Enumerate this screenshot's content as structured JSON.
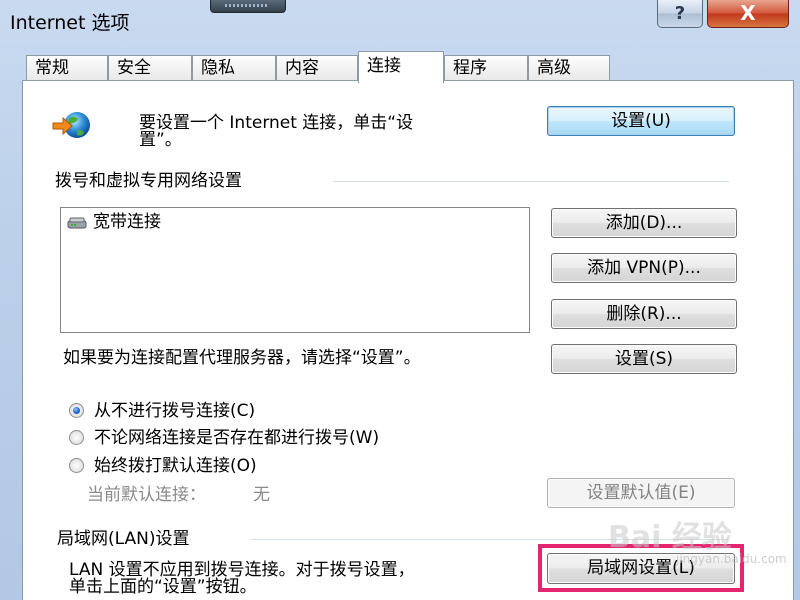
{
  "window": {
    "title": "Internet 选项",
    "help_label": "?",
    "close_label": "X"
  },
  "tabs": [
    {
      "label": "常规"
    },
    {
      "label": "安全"
    },
    {
      "label": "隐私"
    },
    {
      "label": "内容"
    },
    {
      "label": "连接",
      "active": true
    },
    {
      "label": "程序"
    },
    {
      "label": "高级"
    }
  ],
  "internet_setup": {
    "icon": "globe-arrow-icon",
    "text_line1": "要设置一个 Internet 连接，单击“设",
    "text_line2": "置”。",
    "button": "设置(U)"
  },
  "dialup": {
    "section_title": "拨号和虚拟专用网络设置",
    "connections": [
      {
        "icon": "modem-icon",
        "name": "宽带连接"
      }
    ],
    "add_button": "添加(D)...",
    "add_vpn_button": "添加 VPN(P)...",
    "remove_button": "删除(R)...",
    "proxy_text": "如果要为连接配置代理服务器，请选择“设置”。",
    "settings_button": "设置(S)",
    "radio_options": [
      {
        "label": "从不进行拨号连接(C)",
        "checked": true
      },
      {
        "label": "不论网络连接是否存在都进行拨号(W)",
        "checked": false
      },
      {
        "label": "始终拨打默认连接(O)",
        "checked": false
      }
    ],
    "current_default_label": "当前默认连接：",
    "current_default_value": "无",
    "set_default_button": "设置默认值(E)"
  },
  "lan": {
    "section_title": "局域网(LAN)设置",
    "text_line1": "LAN 设置不应用到拨号连接。对于拨号设置，",
    "text_line2": "单击上面的“设置”按钮。",
    "button": "局域网设置(L)"
  },
  "watermark": {
    "text": "Bai 经验",
    "subtext": "jingyan.baidu.com"
  }
}
